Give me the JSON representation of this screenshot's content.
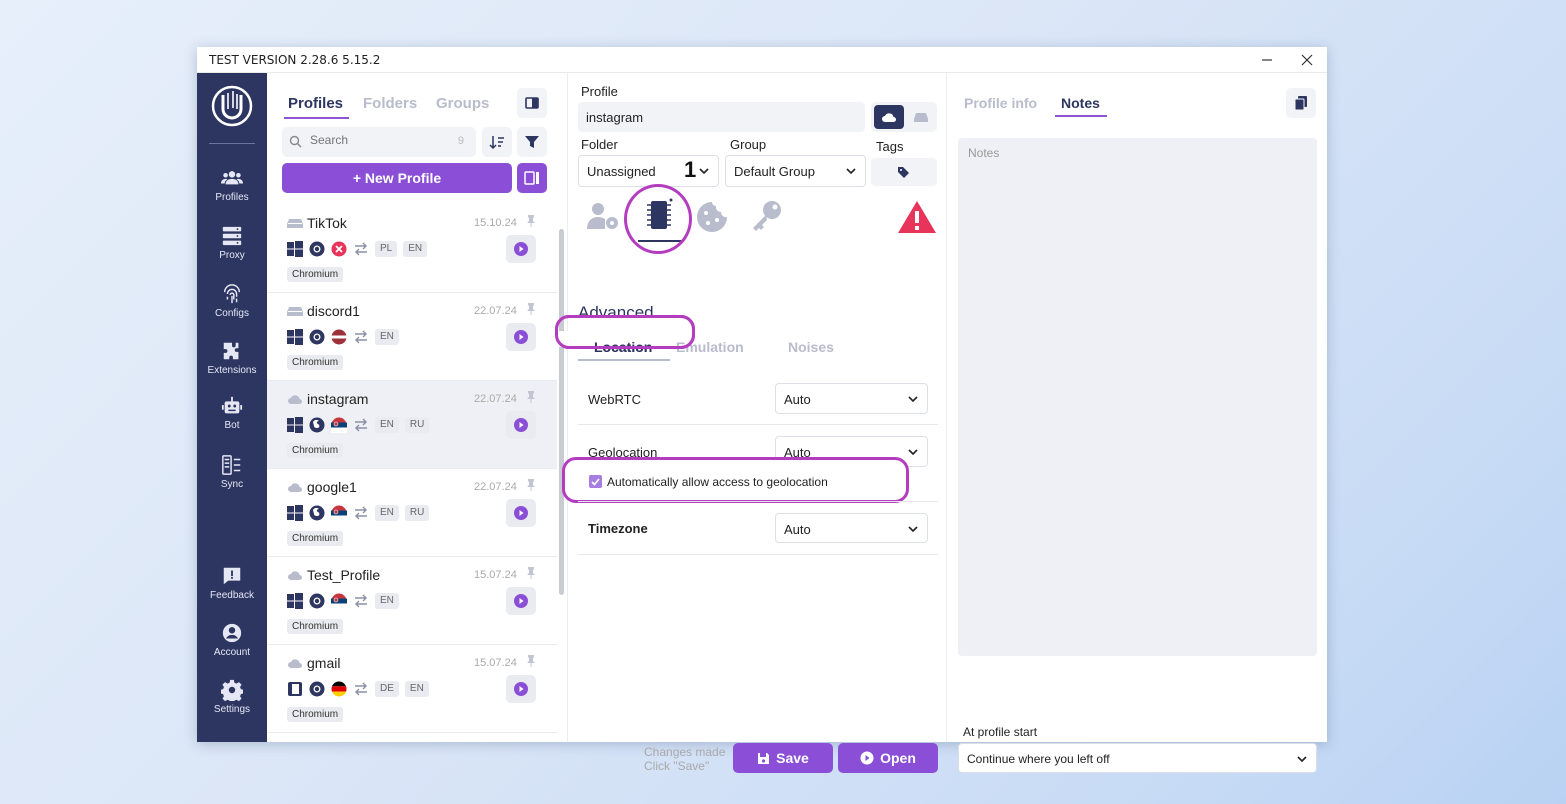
{
  "window": {
    "title": "TEST VERSION 2.28.6 5.15.2",
    "minimize": "—",
    "close": "✕"
  },
  "nav": {
    "items": [
      {
        "label": "Profiles",
        "icon": "users-icon"
      },
      {
        "label": "Proxy",
        "icon": "server-icon"
      },
      {
        "label": "Configs",
        "icon": "fingerprint-icon"
      },
      {
        "label": "Extensions",
        "icon": "puzzle-icon"
      },
      {
        "label": "Bot",
        "icon": "robot-icon"
      },
      {
        "label": "Sync",
        "icon": "sync-icon"
      },
      {
        "label": "Feedback",
        "icon": "feedback-icon"
      },
      {
        "label": "Account",
        "icon": "account-icon"
      },
      {
        "label": "Settings",
        "icon": "gear-icon"
      }
    ]
  },
  "profiles_panel": {
    "tabs": [
      "Profiles",
      "Folders",
      "Groups"
    ],
    "search": {
      "placeholder": "Search",
      "count": "9"
    },
    "new_profile": "+ New Profile",
    "profiles": [
      {
        "name": "TikTok",
        "date": "15.10.24",
        "storage": "local",
        "langs": [
          "PL",
          "EN"
        ],
        "browser": "Chromium",
        "flag": "error"
      },
      {
        "name": "discord1",
        "date": "22.07.24",
        "storage": "local",
        "langs": [
          "EN"
        ],
        "browser": "Chromium",
        "flag": "latvia"
      },
      {
        "name": "instagram",
        "date": "22.07.24",
        "storage": "cloud",
        "langs": [
          "EN",
          "RU"
        ],
        "browser": "Chromium",
        "flag": "serbia"
      },
      {
        "name": "google1",
        "date": "22.07.24",
        "storage": "cloud",
        "langs": [
          "EN",
          "RU"
        ],
        "browser": "Chromium",
        "flag": "serbia"
      },
      {
        "name": "Test_Profile",
        "date": "15.07.24",
        "storage": "cloud",
        "langs": [
          "EN"
        ],
        "browser": "Chromium",
        "flag": "serbia"
      },
      {
        "name": "gmail",
        "date": "15.07.24",
        "storage": "cloud",
        "langs": [
          "DE",
          "EN"
        ],
        "browser": "Chromium",
        "flag": "germany"
      }
    ]
  },
  "editor": {
    "profile_label": "Profile",
    "profile_value": "instagram",
    "folder_label": "Folder",
    "folder_value": "Unassigned",
    "folder_marker": "1",
    "group_label": "Group",
    "group_value": "Default Group",
    "tags_label": "Tags",
    "section_title": "Advanced",
    "subtabs": [
      "Location",
      "Emulation",
      "Noises"
    ],
    "webrtc_label": "WebRTC",
    "webrtc_value": "Auto",
    "geolocation_label": "Geolocation",
    "geolocation_value": "Auto",
    "geo_checkbox_label": "Automatically allow access to geolocation",
    "geo_checkbox_checked": true,
    "timezone_label": "Timezone",
    "timezone_value": "Auto",
    "changes_line1": "Changes made",
    "changes_line2": "Click \"Save\"",
    "save": "Save",
    "open": "Open"
  },
  "right_panel": {
    "tabs": [
      "Profile info",
      "Notes"
    ],
    "notes_placeholder": "Notes",
    "start_label": "At profile start",
    "start_value": "Continue where you left off"
  },
  "colors": {
    "nav_bg": "#2d3561",
    "accent": "#8a4fd6",
    "highlight": "#b43dbf",
    "danger": "#e8335a"
  }
}
